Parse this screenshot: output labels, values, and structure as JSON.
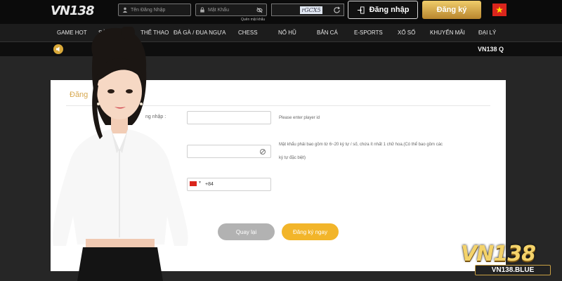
{
  "header": {
    "logo_text": "VN138",
    "username_placeholder": "Tên Đăng Nhập",
    "password_placeholder": "Mật Khẩu",
    "forgot_password": "Quên mật khẩu",
    "captcha_text": "rGCX5",
    "login_label": "Đăng nhập",
    "register_label": "Đăng ký",
    "language_flag": "vn-flag"
  },
  "nav": {
    "items": [
      "GAME HOT",
      "SÒNG BÀI",
      "THỂ THAO",
      "ĐÁ GÀ / ĐUA NGỰA",
      "CHESS",
      "NỔ HŨ",
      "BẮN CÁ",
      "E-SPORTS",
      "XỔ SỐ",
      "KHUYẾN MÃI",
      "ĐẠI LÝ"
    ]
  },
  "marquee": {
    "text": "VN138 Q"
  },
  "form": {
    "title": "Đăng",
    "username_label": "ng nhập :",
    "username_hint": "Please enter player id",
    "password_hint_line1": "Mật khẩu phải bao gồm từ 6~20 ký tự / số, chứa ít nhất 1 chữ hoa.(Có thể bao gồm các",
    "password_hint_line2": "ký tự đặc biệt)",
    "phone_prefix": "+84",
    "back_label": "Quay lại",
    "submit_label": "Đăng ký ngay"
  },
  "watermark": {
    "brand": "VN138",
    "domain": "VN138.BLUE"
  },
  "colors": {
    "accent_gold": "#d7a84f",
    "button_gold": "#f2b52a",
    "top_bar": "#0b0b0b",
    "nav_bar": "#1c1c1c"
  }
}
